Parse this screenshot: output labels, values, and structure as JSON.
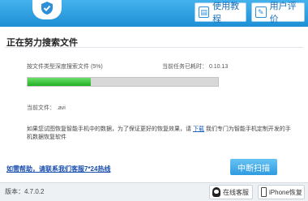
{
  "header": {
    "tutorial_label": "使用教程",
    "review_label": "用户评价",
    "logo_icon": "shield-logo-icon",
    "colors": {
      "bar_top": "#43b2ec",
      "bar_bottom": "#1f8fd6"
    }
  },
  "main": {
    "title": "正在努力搜索文件",
    "scan_label": "按文件类型深度搜索文件 (5%)",
    "elapsed_label": "当前任务已耗时： 0.10.13",
    "progress": 0.33,
    "current_file": "当前文件： .avi",
    "notice_part1": "如果您试图恢复智能手机中的数据，为了保证更好的恢复效果，请",
    "notice_link": "下载",
    "notice_part2": "我们专门为智能手机定制开发的手机数据恢复软件",
    "help_link": "如需帮助，请联系我们客服7*24热线",
    "interrupt_label": "中断扫描",
    "progress_color": "#2ec42e"
  },
  "footer": {
    "version": "版本：4.7.0.2",
    "service_label": "在线客服",
    "iphone_label": "iPhone恢复"
  }
}
